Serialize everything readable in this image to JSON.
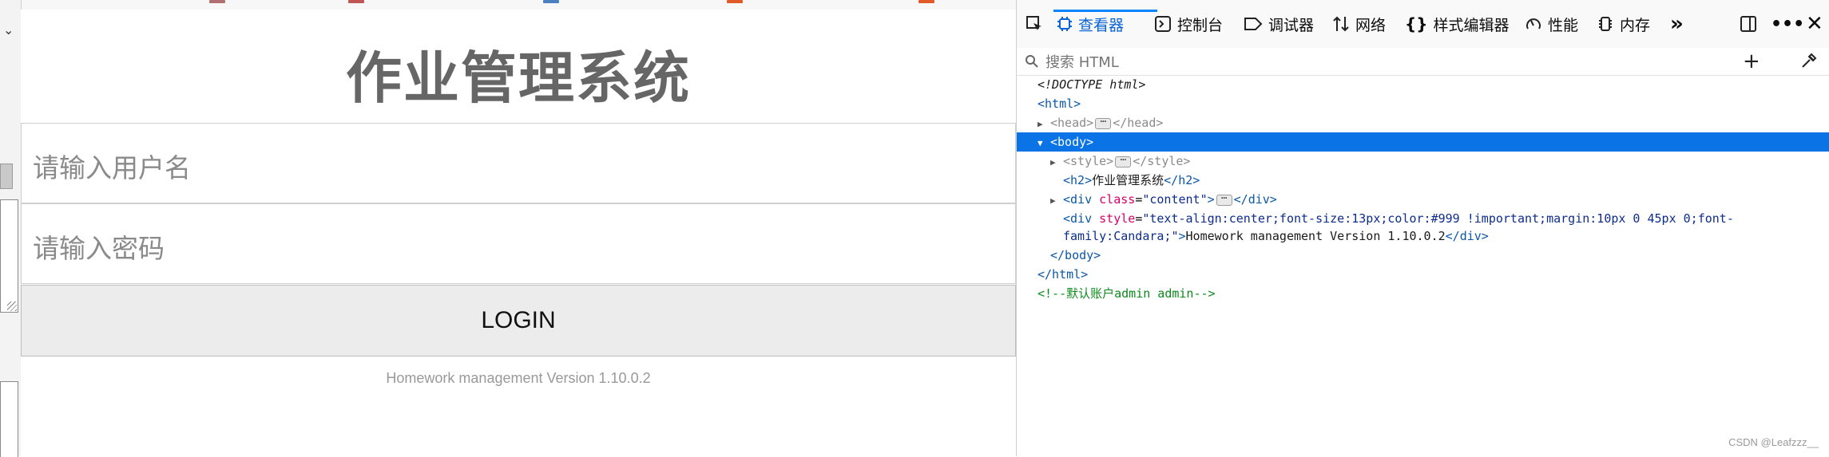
{
  "page": {
    "title": "作业管理系统",
    "username_placeholder": "请输入用户名",
    "password_placeholder": "请输入密码",
    "login_label": "LOGIN",
    "version": "Homework management Version 1.10.0.2"
  },
  "devtools": {
    "tabs": [
      "查看器",
      "控制台",
      "调试器",
      "网络",
      "样式编辑器",
      "性能",
      "内存"
    ],
    "active_tab": "查看器",
    "search_placeholder": "搜索 HTML",
    "tree": {
      "doctype": "<!DOCTYPE html>",
      "html_open": "<html>",
      "head_open": "<head>",
      "head_close": "</head>",
      "body_open": "<body>",
      "style_open": "<style>",
      "style_close": "</style>",
      "h2_open": "<h2>",
      "h2_text": "作业管理系统",
      "h2_close": "</h2>",
      "div_open": "<div",
      "div_class_attr": "class",
      "div_class_val": "\"content\"",
      "div_gt": ">",
      "div_close": "</div>",
      "div2_open": "<div",
      "div2_style_attr": "style",
      "div2_style_val_1": "\"text-align:center;font-size:13px;color:#999 !important;margin:10px 0 45px 0;font-",
      "div2_style_val_2": "family:Candara;\"",
      "div2_gt": ">",
      "div2_text": "Homework management Version 1.10.0.2",
      "div2_close": "</div>",
      "body_close": "</body>",
      "html_close": "</html>",
      "comment": "<!--默认账户admin admin-->"
    }
  },
  "watermark": "CSDN @Leafzzz__",
  "colors": {
    "selection": "#0a73e6",
    "tag": "#0b57a8",
    "attr": "#d6006a",
    "comment": "#0d8a1c"
  }
}
